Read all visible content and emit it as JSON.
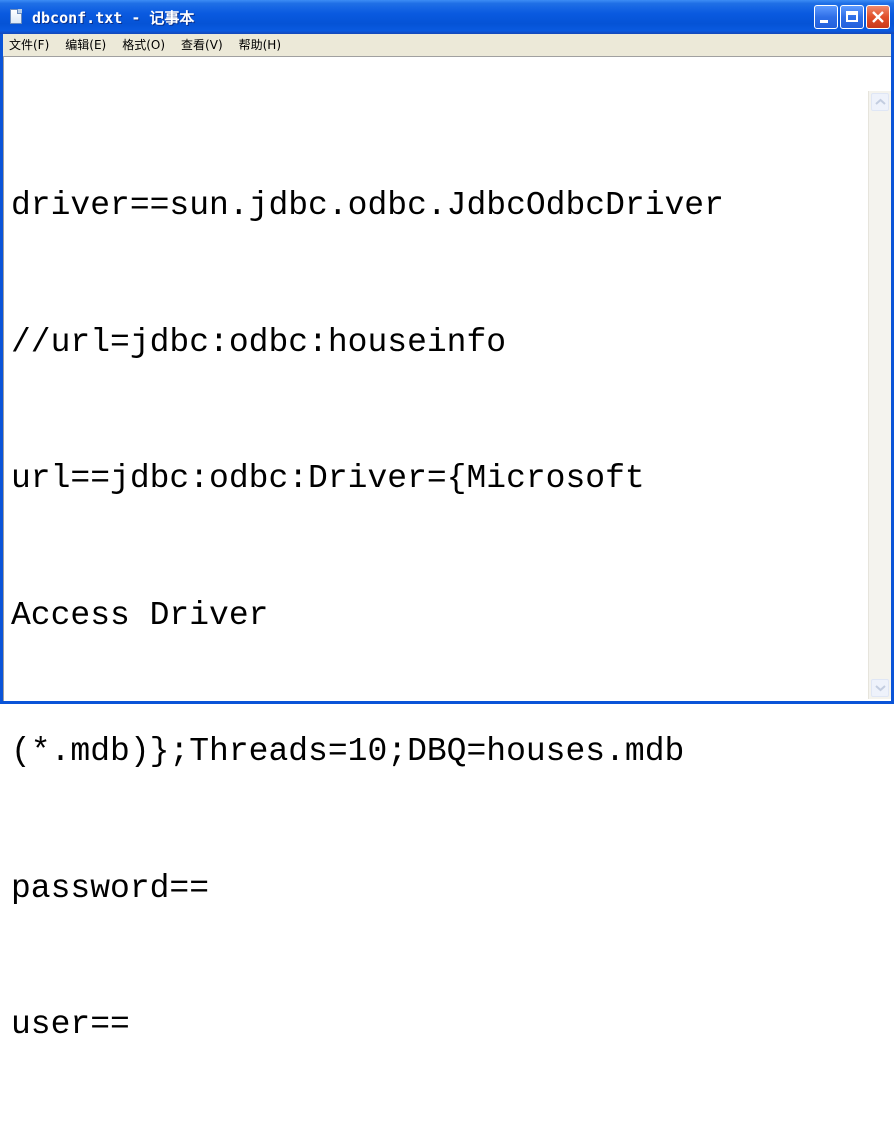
{
  "window": {
    "title": "dbconf.txt - 记事本",
    "icon": "notepad-file-icon",
    "title_text_color": "#ffffff",
    "titlebar_color": "#0a5ae0",
    "controls": {
      "minimize": "minimize-icon",
      "maximize": "maximize-icon",
      "close": "close-icon"
    }
  },
  "menu": {
    "items": [
      {
        "label": "文件(F)"
      },
      {
        "label": "编辑(E)"
      },
      {
        "label": "格式(O)"
      },
      {
        "label": "查看(V)"
      },
      {
        "label": "帮助(H)"
      }
    ]
  },
  "document": {
    "lines": [
      "driver==sun.jdbc.odbc.JdbcOdbcDriver",
      "//url=jdbc:odbc:houseinfo",
      "url==jdbc:odbc:Driver={Microsoft",
      "Access Driver",
      "(*.mdb)};Threads=10;DBQ=houses.mdb",
      "password==",
      "user=="
    ]
  },
  "scrollbar": {
    "up": "scroll-up-arrow-icon",
    "down": "scroll-down-arrow-icon"
  }
}
